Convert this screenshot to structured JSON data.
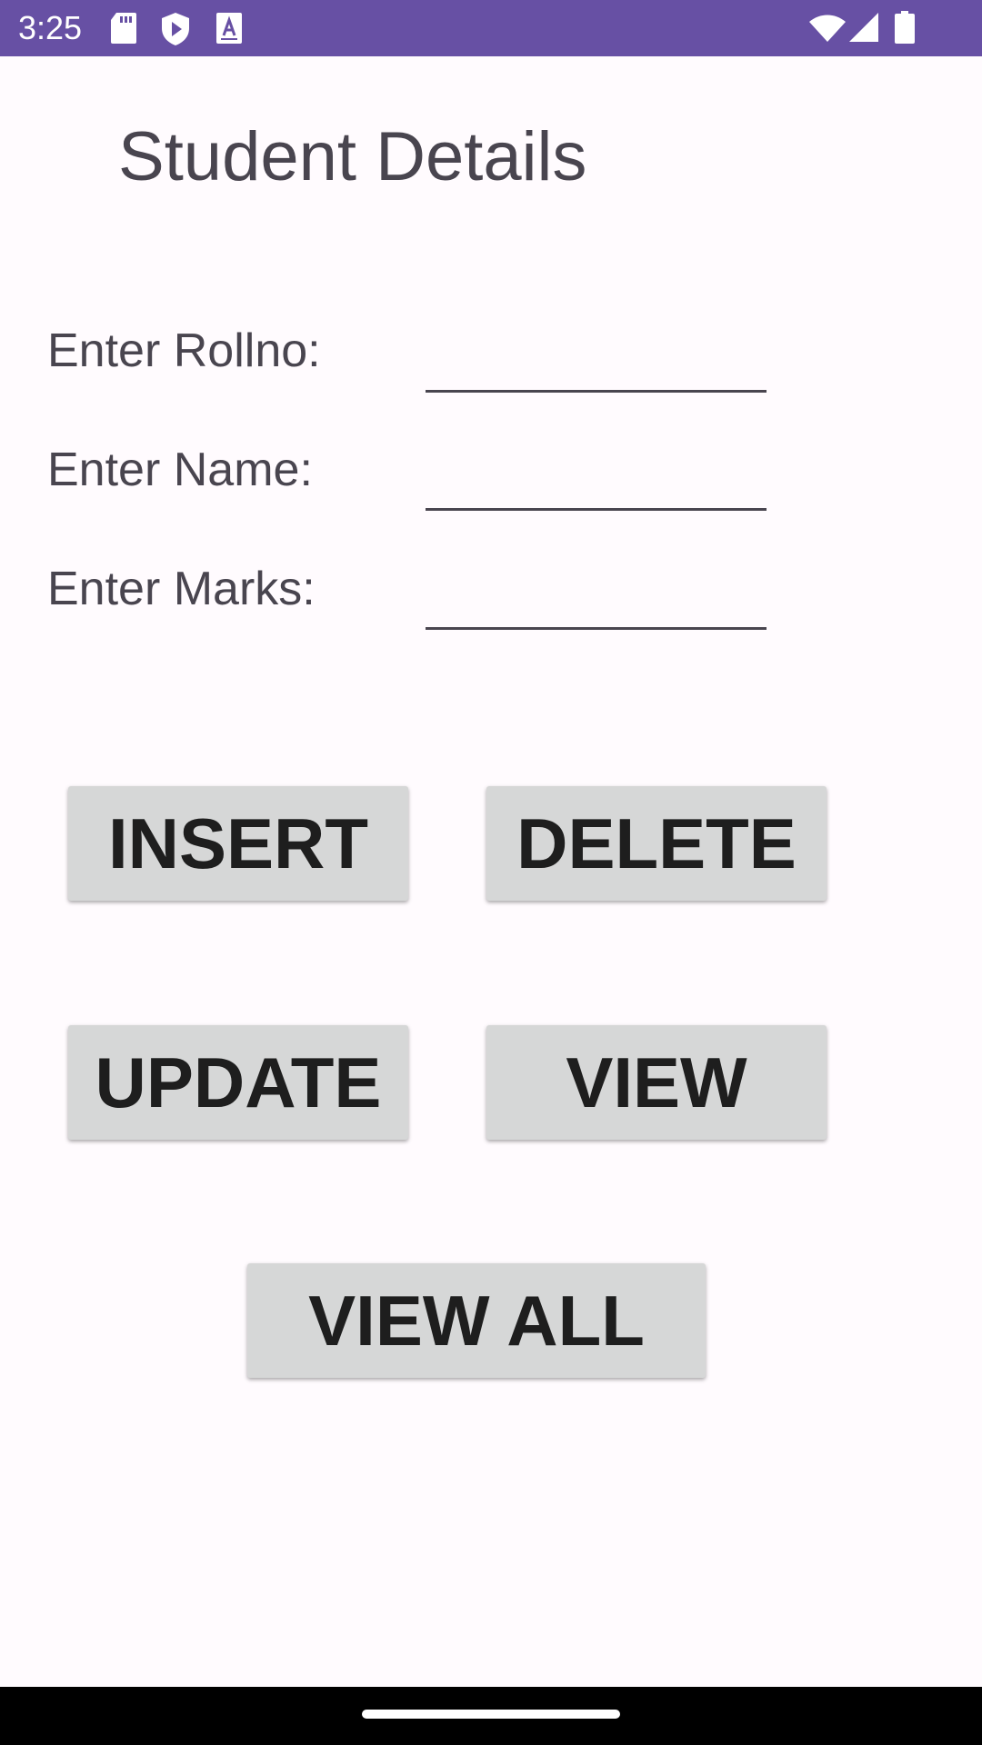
{
  "status_bar": {
    "time": "3:25",
    "left_icons": [
      "sd-card-icon",
      "play-protect-icon",
      "font-a-icon"
    ],
    "right_icons": [
      "wifi-icon",
      "signal-icon",
      "battery-icon"
    ],
    "color": "#6750a4"
  },
  "app": {
    "title": "Student Details"
  },
  "form": {
    "rollno_label": "Enter Rollno:",
    "rollno_value": "",
    "name_label": "Enter Name:",
    "name_value": "",
    "marks_label": "Enter Marks:",
    "marks_value": ""
  },
  "buttons": {
    "insert": "INSERT",
    "delete": "DELETE",
    "update": "UPDATE",
    "view": "VIEW",
    "view_all": "VIEW ALL"
  },
  "colors": {
    "accent": "#6750a4",
    "background": "#fffbfe",
    "button_bg": "#d6d7d7",
    "text": "#49454f"
  }
}
